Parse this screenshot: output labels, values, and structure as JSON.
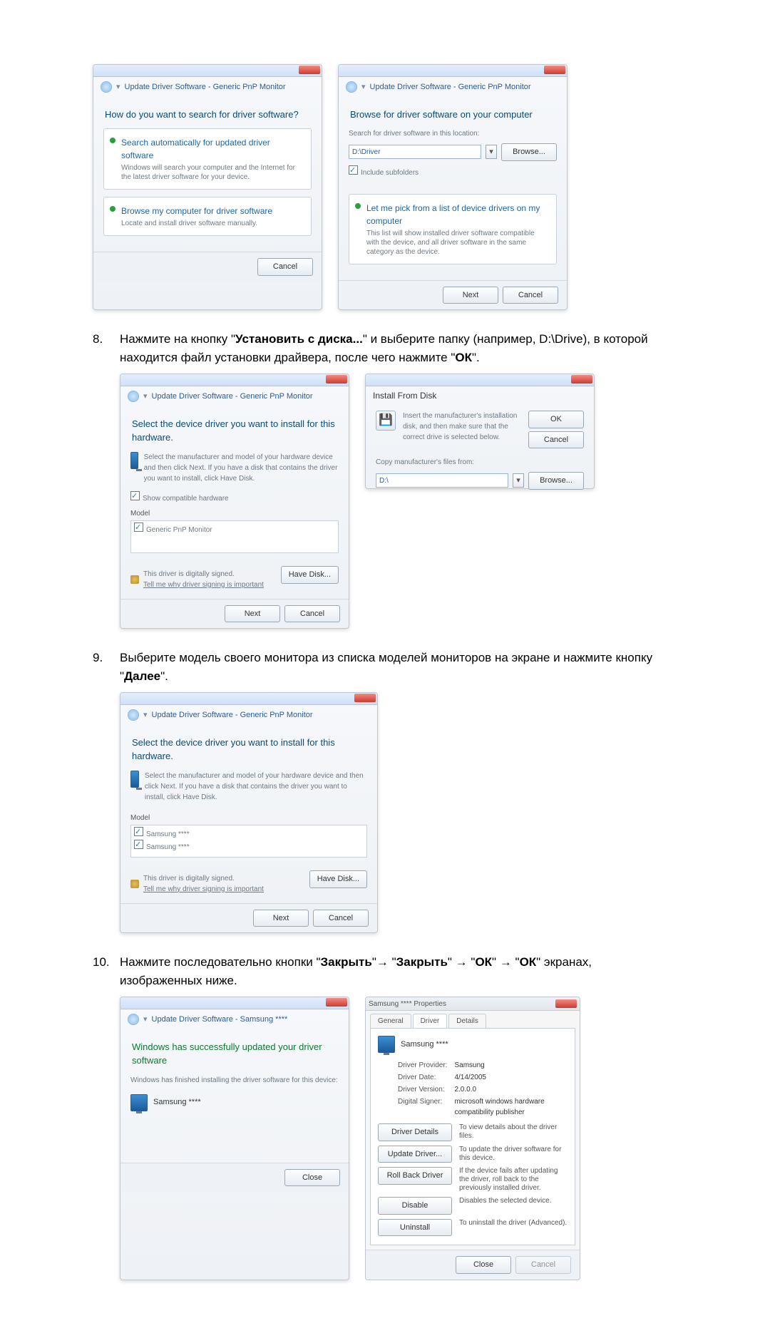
{
  "steps": {
    "s8": {
      "num": "8.",
      "text_pre": "Нажмите на кнопку \"",
      "b1": "Установить с диска...",
      "mid": "\" и выберите папку (например, D:\\Drive), в которой находится файл установки драйвера, после чего нажмите \"",
      "b2": "ОК",
      "post": "\"."
    },
    "s9": {
      "num": "9.",
      "text_pre": "Выберите модель своего монитора из списка моделей мониторов на экране и нажмите кнопку \"",
      "b1": "Далее",
      "post": "\"."
    },
    "s10": {
      "num": "10.",
      "text_pre": "Нажмите последовательно кнопки \"",
      "b1": "Закрыть",
      "m1": "\"→ \"",
      "b2": "Закрыть",
      "m2": "\" → \"",
      "b3": "ОК",
      "m3": "\" → \"",
      "b4": "ОК",
      "post": "\" экранах, изображенных ниже."
    }
  },
  "dlg_update": {
    "crumb": "Update Driver Software - Generic PnP Monitor"
  },
  "dlg_a": {
    "heading": "How do you want to search for driver software?",
    "opt1_title": "Search automatically for updated driver software",
    "opt1_sub": "Windows will search your computer and the Internet for the latest driver software for your device.",
    "opt2_title": "Browse my computer for driver software",
    "opt2_sub": "Locate and install driver software manually.",
    "cancel": "Cancel"
  },
  "dlg_b": {
    "heading": "Browse for driver software on your computer",
    "loc_label": "Search for driver software in this location:",
    "loc_value": "D:\\Driver",
    "browse": "Browse...",
    "sub_chk": "Include subfolders",
    "opt_title": "Let me pick from a list of device drivers on my computer",
    "opt_sub": "This list will show installed driver software compatible with the device, and all driver software in the same category as the device.",
    "next": "Next",
    "cancel": "Cancel"
  },
  "dlg_c": {
    "heading": "Select the device driver you want to install for this hardware.",
    "sub": "Select the manufacturer and model of your hardware device and then click Next. If you have a disk that contains the driver you want to install, click Have Disk.",
    "show_compatible": "Show compatible hardware",
    "model_hdr": "Model",
    "model_item": "Generic PnP Monitor",
    "signed": "This driver is digitally signed.",
    "tell": "Tell me why driver signing is important",
    "have_disk": "Have Disk...",
    "next": "Next",
    "cancel": "Cancel"
  },
  "dlg_d": {
    "title": "Install From Disk",
    "msg": "Insert the manufacturer's installation disk, and then make sure that the correct drive is selected below.",
    "ok": "OK",
    "cancel": "Cancel",
    "copy_label": "Copy manufacturer's files from:",
    "copy_value": "D:\\",
    "browse": "Browse..."
  },
  "dlg_e": {
    "heading": "Select the device driver you want to install for this hardware.",
    "sub": "Select the manufacturer and model of your hardware device and then click Next. If you have a disk that contains the driver you want to install, click Have Disk.",
    "model_hdr": "Model",
    "m1": "Samsung ****",
    "m2": "Samsung ****",
    "signed": "This driver is digitally signed.",
    "tell": "Tell me why driver signing is important",
    "have_disk": "Have Disk...",
    "next": "Next",
    "cancel": "Cancel"
  },
  "dlg_f": {
    "crumb": "Update Driver Software - Samsung ****",
    "heading": "Windows has successfully updated your driver software",
    "sub": "Windows has finished installing the driver software for this device:",
    "dev": "Samsung ****",
    "close": "Close"
  },
  "dlg_g": {
    "title": "Samsung **** Properties",
    "tab_general": "General",
    "tab_driver": "Driver",
    "tab_details": "Details",
    "dev": "Samsung ****",
    "kv": {
      "provider_k": "Driver Provider:",
      "provider_v": "Samsung",
      "date_k": "Driver Date:",
      "date_v": "4/14/2005",
      "ver_k": "Driver Version:",
      "ver_v": "2.0.0.0",
      "sig_k": "Digital Signer:",
      "sig_v": "microsoft windows hardware compatibility publisher"
    },
    "b1": "Driver Details",
    "d1": "To view details about the driver files.",
    "b2": "Update Driver...",
    "d2": "To update the driver software for this device.",
    "b3": "Roll Back Driver",
    "d3": "If the device fails after updating the driver, roll back to the previously installed driver.",
    "b4": "Disable",
    "d4": "Disables the selected device.",
    "b5": "Uninstall",
    "d5": "To uninstall the driver (Advanced).",
    "ok": "Close",
    "cancel": "Cancel"
  }
}
